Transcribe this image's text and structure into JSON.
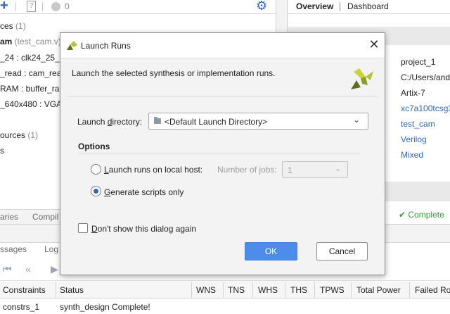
{
  "left_panel": {
    "toolbar": {
      "count": "0"
    },
    "tree": [
      {
        "text": "ces",
        "muted": " (1)",
        "bold": false
      },
      {
        "text": "am",
        "muted": " (test_cam.v)",
        "bold": true
      },
      {
        "text": "_24 : clk24_25_",
        "muted": "",
        "bold": false
      },
      {
        "text": "_read : cam_rea",
        "muted": "",
        "bold": false
      },
      {
        "text": "RAM : buffer_ram",
        "muted": "",
        "bold": false
      },
      {
        "text": "_640x480 : VGA_",
        "muted": "",
        "bold": false
      },
      {
        "text": "ources",
        "muted": " (1)",
        "bold": false
      },
      {
        "text": "s",
        "muted": "",
        "bold": false
      }
    ],
    "tabs": [
      "aries",
      "Compil"
    ]
  },
  "right_panel": {
    "tabs": {
      "overview": "Overview",
      "dashboard": "Dashboard"
    },
    "properties": [
      "project_1",
      "C:/Users/and",
      "Artix-7",
      "xc7a100tcsg3",
      "test_cam",
      "Verilog",
      "Mixed"
    ],
    "footer_status": "Complete"
  },
  "bottom_panel": {
    "tabs": [
      "ssages",
      "Log"
    ],
    "runs_table": {
      "columns": [
        "Constraints",
        "Status",
        "WNS",
        "TNS",
        "WHS",
        "THS",
        "TPWS",
        "Total Power",
        "Failed Ro"
      ],
      "rows": [
        {
          "constraints": "constrs_1",
          "status": "synth_design Complete!"
        }
      ]
    }
  },
  "dialog": {
    "title": "Launch Runs",
    "description": "Launch the selected synthesis or implementation runs.",
    "launch_directory": {
      "label_before": "Launch ",
      "label_mnemonic": "d",
      "label_after": "irectory:",
      "value": "<Default Launch Directory>"
    },
    "options_title": "Options",
    "radio_local": {
      "label_before": "",
      "label_mnemonic": "L",
      "label_after": "aunch runs on local host:",
      "checked": false
    },
    "jobs": {
      "label_before": "Number of ",
      "label_mnemonic": "j",
      "label_after": "obs:",
      "value": "1"
    },
    "radio_scripts": {
      "label_before": "",
      "label_mnemonic": "G",
      "label_after": "enerate scripts only",
      "checked": true
    },
    "dont_show": {
      "label_before": "",
      "label_mnemonic": "D",
      "label_after": "on't show this dialog again",
      "checked": false
    },
    "ok_label": "OK",
    "cancel_label": "Cancel"
  },
  "colors": {
    "accent_blue": "#2e67c2",
    "ok_button": "#4d8ce8",
    "logo_yellow": "#b6c434",
    "logo_dark": "#5f6f1e"
  },
  "icons": [
    "add-icon",
    "help-icon",
    "status-dot-icon",
    "gear-icon",
    "close-icon",
    "vivado-logo-icon",
    "folder-icon",
    "chevron-down-icon",
    "first-page-icon",
    "previous-page-icon",
    "play-icon",
    "check-icon"
  ]
}
